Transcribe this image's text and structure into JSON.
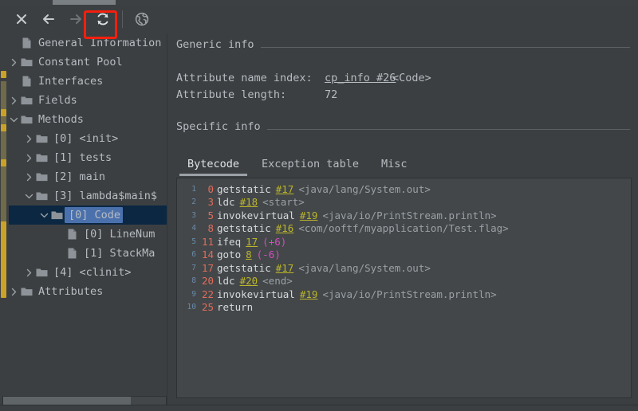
{
  "toolbar": {
    "buttons": [
      {
        "name": "close-icon",
        "label": "✕",
        "enabled": true
      },
      {
        "name": "back-arrow-icon",
        "label": "←",
        "enabled": true
      },
      {
        "name": "forward-arrow-icon",
        "label": "→",
        "enabled": false
      },
      {
        "name": "reload-icon",
        "label": "⟳",
        "enabled": true
      },
      {
        "name": "globe-icon",
        "label": "ἱ0",
        "enabled": true
      }
    ],
    "highlight_color": "#f41f0e"
  },
  "tree": {
    "items": [
      {
        "label": "General Information",
        "icon": "file-icon",
        "arrow": "none",
        "indent": 0,
        "selected": false
      },
      {
        "label": "Constant Pool",
        "icon": "folder-icon",
        "arrow": "right",
        "indent": 0,
        "selected": false
      },
      {
        "label": "Interfaces",
        "icon": "file-icon",
        "arrow": "none",
        "indent": 0,
        "selected": false
      },
      {
        "label": "Fields",
        "icon": "folder-icon",
        "arrow": "right",
        "indent": 0,
        "selected": false
      },
      {
        "label": "Methods",
        "icon": "folder-icon",
        "arrow": "down",
        "indent": 0,
        "selected": false
      },
      {
        "label": "[0] <init>",
        "icon": "folder-icon",
        "arrow": "right",
        "indent": 1,
        "selected": false
      },
      {
        "label": "[1] tests",
        "icon": "folder-icon",
        "arrow": "right",
        "indent": 1,
        "selected": false
      },
      {
        "label": "[2] main",
        "icon": "folder-icon",
        "arrow": "right",
        "indent": 1,
        "selected": false
      },
      {
        "label": "[3] lambda$main$",
        "icon": "folder-icon",
        "arrow": "down",
        "indent": 1,
        "selected": false
      },
      {
        "label": "[0] Code",
        "icon": "folder-icon",
        "arrow": "down",
        "indent": 2,
        "selected": true
      },
      {
        "label": "[0] LineNum",
        "icon": "file-icon",
        "arrow": "none",
        "indent": 3,
        "selected": false
      },
      {
        "label": "[1] StackMa",
        "icon": "file-icon",
        "arrow": "none",
        "indent": 3,
        "selected": false
      },
      {
        "label": "[4] <clinit>",
        "icon": "folder-icon",
        "arrow": "right",
        "indent": 1,
        "selected": false
      },
      {
        "label": "Attributes",
        "icon": "folder-icon",
        "arrow": "right",
        "indent": 0,
        "selected": false
      }
    ]
  },
  "detail": {
    "generic_section": "Generic info",
    "specific_section": "Specific info",
    "attribute_name_index_label": "Attribute name index:",
    "attribute_name_index_link": "cp_info #26",
    "attribute_name_index_type": "<Code>",
    "attribute_length_label": "Attribute length:",
    "attribute_length_value": "72"
  },
  "tabs": [
    {
      "label": "Bytecode",
      "active": true
    },
    {
      "label": "Exception table",
      "active": false
    },
    {
      "label": "Misc",
      "active": false
    }
  ],
  "bytecode": {
    "lines": [
      {
        "n": "1",
        "offset": "0",
        "op": "getstatic",
        "ref": "#17",
        "desc": "<java/lang/System.out>",
        "jump": ""
      },
      {
        "n": "2",
        "offset": "3",
        "op": "ldc",
        "ref": "#18",
        "desc": "<start>",
        "jump": ""
      },
      {
        "n": "3",
        "offset": "5",
        "op": "invokevirtual",
        "ref": "#19",
        "desc": "<java/io/PrintStream.println>",
        "jump": ""
      },
      {
        "n": "4",
        "offset": "8",
        "op": "getstatic",
        "ref": "#16",
        "desc": "<com/ooftf/myapplication/Test.flag>",
        "jump": ""
      },
      {
        "n": "5",
        "offset": "11",
        "op": "ifeq",
        "ref": "17",
        "desc": "",
        "jump": "(+6)"
      },
      {
        "n": "6",
        "offset": "14",
        "op": "goto",
        "ref": "8",
        "desc": "",
        "jump": "(-6)"
      },
      {
        "n": "7",
        "offset": "17",
        "op": "getstatic",
        "ref": "#17",
        "desc": "<java/lang/System.out>",
        "jump": ""
      },
      {
        "n": "8",
        "offset": "20",
        "op": "ldc",
        "ref": "#20",
        "desc": "<end>",
        "jump": ""
      },
      {
        "n": "9",
        "offset": "22",
        "op": "invokevirtual",
        "ref": "#19",
        "desc": "<java/io/PrintStream.println>",
        "jump": ""
      },
      {
        "n": "10",
        "offset": "25",
        "op": "return",
        "ref": "",
        "desc": "",
        "jump": ""
      }
    ]
  },
  "colors": {
    "background": "#3c3f41",
    "code_background": "#434749",
    "text": "#b6bcc2",
    "link": "#bbb529",
    "offset": "#e06c5a",
    "jump": "#d24ec0",
    "selection": "#4b71ac",
    "selection_row": "#0b2742",
    "marker": "#c9a227"
  }
}
